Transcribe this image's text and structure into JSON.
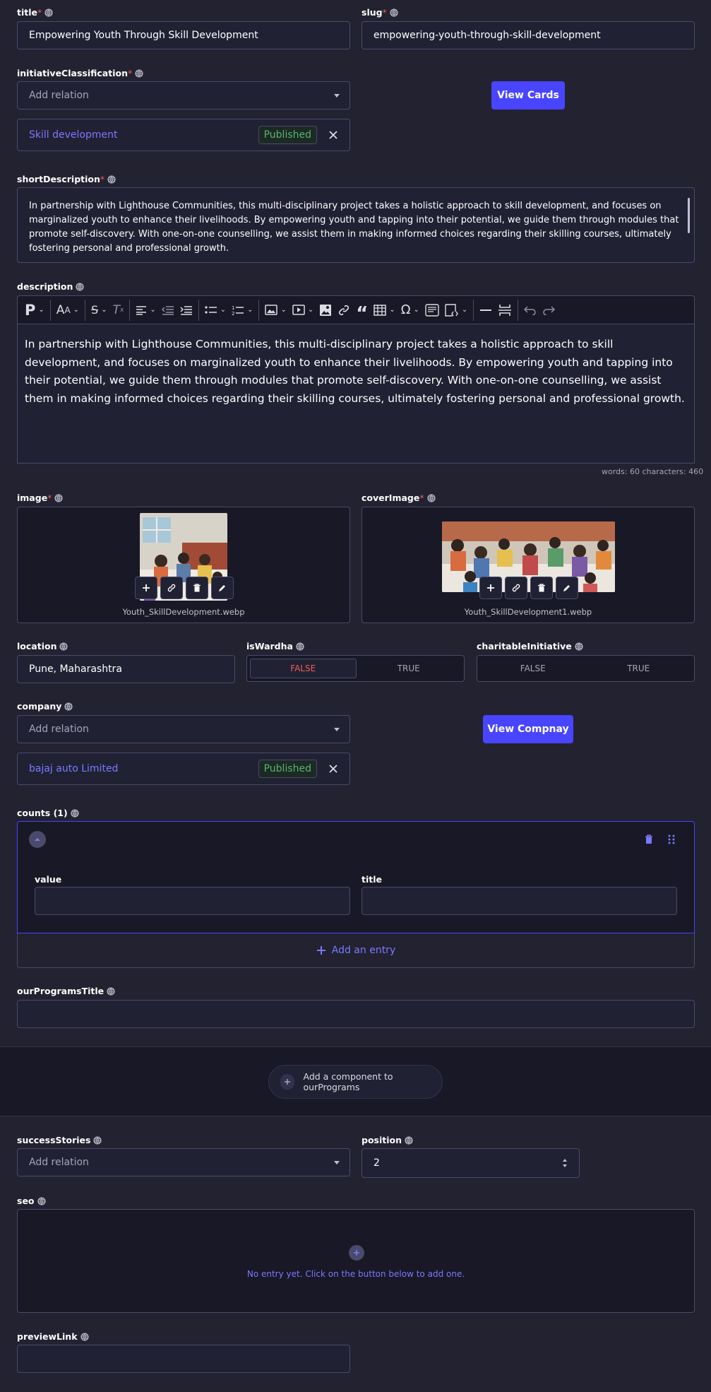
{
  "fields": {
    "title": {
      "label": "title",
      "required": "*",
      "value": "Empowering Youth Through Skill Development"
    },
    "slug": {
      "label": "slug",
      "required": "*",
      "value": "empowering-youth-through-skill-development"
    },
    "initiativeClassification": {
      "label": "initiativeClassification",
      "required": "*",
      "placeholder": "Add relation",
      "button": "View Cards",
      "item": "Skill development",
      "status": "Published"
    },
    "shortDescription": {
      "label": "shortDescription",
      "required": "*",
      "value": "In partnership with Lighthouse Communities, this multi-disciplinary project takes a holistic approach to skill development, and focuses on marginalized youth to enhance their livelihoods. By empowering youth and tapping into their potential, we guide them through modules that promote self-discovery. With one-on-one counselling, we assist them in making informed choices regarding their skilling courses, ultimately fostering personal and professional growth."
    },
    "description": {
      "label": "description",
      "value": "In partnership with Lighthouse Communities, this multi-disciplinary project takes a holistic approach to skill development, and focuses on marginalized youth to enhance their livelihoods. By empowering youth and tapping into their potential, we guide them through modules that promote self-discovery. With one-on-one counselling, we assist them in making informed choices regarding their skilling courses, ultimately fostering personal and professional growth.",
      "counter": "words: 60  characters: 460"
    },
    "image": {
      "label": "image",
      "required": "*",
      "filename": "Youth_SkillDevelopment.webp"
    },
    "coverImage": {
      "label": "coverImage",
      "required": "*",
      "filename": "Youth_SkillDevelopment1.webp"
    },
    "location": {
      "label": "location",
      "value": "Pune, Maharashtra"
    },
    "isWardha": {
      "label": "isWardha",
      "false_label": "FALSE",
      "true_label": "TRUE",
      "value": "FALSE"
    },
    "charitableInitiative": {
      "label": "charitableInitiative",
      "false_label": "FALSE",
      "true_label": "TRUE"
    },
    "company": {
      "label": "company",
      "placeholder": "Add relation",
      "button": "View Compnay",
      "item": "bajaj auto Limited",
      "status": "Published"
    },
    "counts": {
      "label": "counts (1)",
      "value_label": "value",
      "title_label": "title",
      "add_entry": "Add an entry"
    },
    "ourProgramsTitle": {
      "label": "ourProgramsTitle",
      "add_component": "Add a component to ourPrograms"
    },
    "successStories": {
      "label": "successStories",
      "placeholder": "Add relation"
    },
    "position": {
      "label": "position",
      "value": "2"
    },
    "seo": {
      "label": "seo",
      "empty": "No entry yet. Click on the button below to add one."
    },
    "previewLink": {
      "label": "previewLink"
    }
  },
  "toolbar_icons": [
    "paragraph-icon",
    "font-size-icon",
    "strikethrough-icon",
    "remove-format-icon",
    "align-icon",
    "outdent-icon",
    "indent-icon",
    "bulleted-list-icon",
    "numbered-list-icon",
    "image-icon",
    "media-embed-icon",
    "image-insert-icon",
    "link-icon",
    "blockquote-icon",
    "table-icon",
    "special-characters-icon",
    "source-editing-icon",
    "html-embed-icon",
    "horizontal-line-icon",
    "page-break-icon",
    "undo-icon",
    "redo-icon"
  ],
  "colors": {
    "background": "#222231",
    "input": "#212134",
    "border": "#4a4a6a",
    "primary": "#4945ff",
    "link": "#7b79ff",
    "success": "#5cb176",
    "danger": "#ee5e52"
  }
}
